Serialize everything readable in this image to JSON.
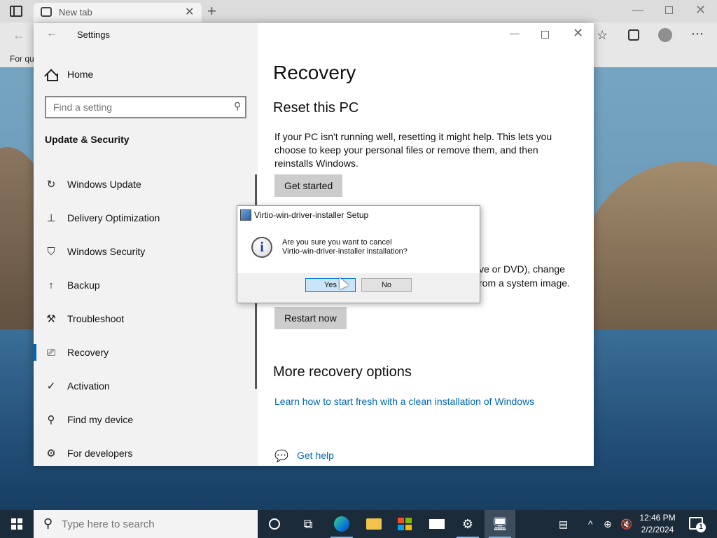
{
  "browser": {
    "tab_title": "New tab",
    "favorites_hint": "For qu"
  },
  "settings": {
    "app_title": "Settings",
    "home_label": "Home",
    "search_placeholder": "Find a setting",
    "section_title": "Update & Security",
    "nav_items": [
      {
        "label": "Windows Update",
        "icon": "refresh-icon"
      },
      {
        "label": "Delivery Optimization",
        "icon": "delivery-icon"
      },
      {
        "label": "Windows Security",
        "icon": "shield-icon"
      },
      {
        "label": "Backup",
        "icon": "upload-icon"
      },
      {
        "label": "Troubleshoot",
        "icon": "wrench-icon"
      },
      {
        "label": "Recovery",
        "icon": "recovery-icon"
      },
      {
        "label": "Activation",
        "icon": "check-circle-icon"
      },
      {
        "label": "Find my device",
        "icon": "person-pin-icon"
      },
      {
        "label": "For developers",
        "icon": "developer-icon"
      }
    ],
    "active_item": "Recovery",
    "page_title": "Recovery",
    "reset_heading": "Reset this PC",
    "reset_text": "If your PC isn't running well, resetting it might help. This lets you choose to keep your personal files or remove them, and then reinstalls Windows.",
    "get_started_label": "Get started",
    "advanced_fragment_1": "ve or DVD), change",
    "advanced_fragment_2": "rom a system image.",
    "restart_label": "Restart now",
    "more_heading": "More recovery options",
    "more_link": "Learn how to start fresh with a clean installation of Windows",
    "help_link": "Get help"
  },
  "dialog": {
    "title": "Virtio-win-driver-installer Setup",
    "message_line1": "Are you sure you want to cancel",
    "message_line2": "Virtio-win-driver-installer installation?",
    "yes_label": "Yes",
    "no_label": "No"
  },
  "taskbar": {
    "search_placeholder": "Type here to search",
    "time": "12:46 PM",
    "date": "2/2/2024",
    "notification_count": "1"
  },
  "colors": {
    "accent": "#0067b8",
    "taskbar": "#1c2b3a"
  }
}
